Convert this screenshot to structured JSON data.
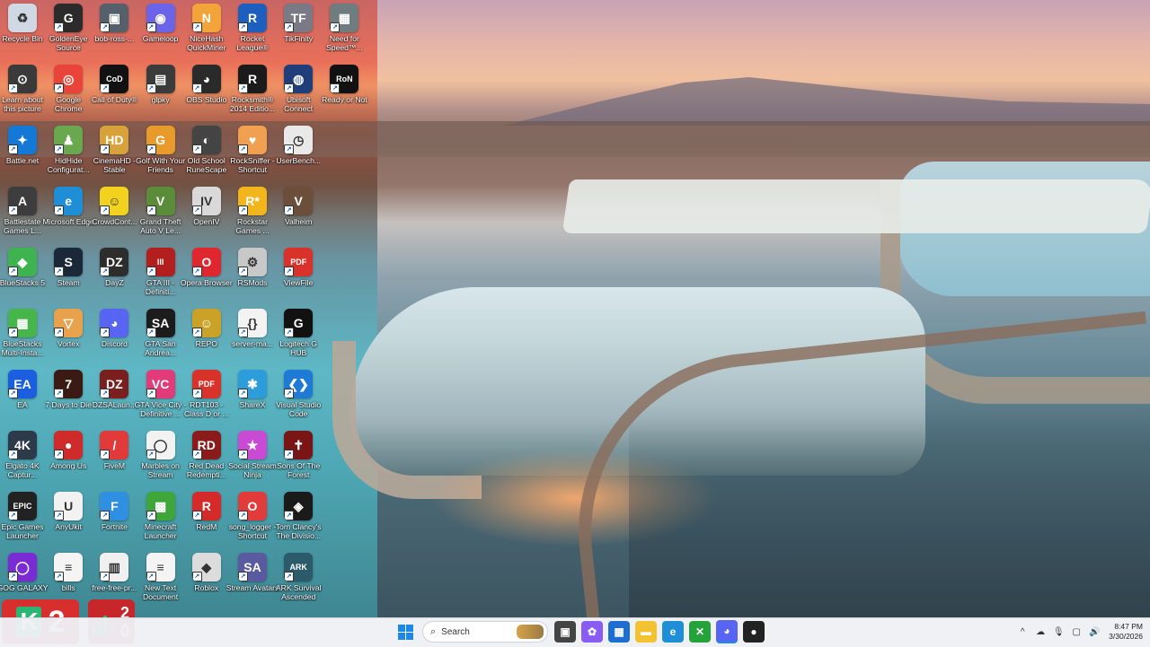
{
  "desktop": {
    "icons": [
      {
        "label": "Recycle Bin",
        "icon": "recycle-bin-icon",
        "color": "#cfd8e3",
        "glyph": "♻",
        "col": 0,
        "row": 0
      },
      {
        "label": "GoldenEye Source",
        "icon": "goldeneye-icon",
        "color": "#2b2b2b",
        "glyph": "G",
        "col": 1,
        "row": 0
      },
      {
        "label": "bob-ross-...",
        "icon": "image-file-icon",
        "color": "#55606a",
        "glyph": "▣",
        "col": 2,
        "row": 0
      },
      {
        "label": "Gameloop",
        "icon": "gameloop-icon",
        "color": "#6b64e8",
        "glyph": "◉",
        "col": 3,
        "row": 0
      },
      {
        "label": "NiceHash QuickMiner",
        "icon": "nicehash-icon",
        "color": "#f2a33a",
        "glyph": "N",
        "col": 4,
        "row": 0
      },
      {
        "label": "Rocket League®",
        "icon": "rocket-league-icon",
        "color": "#1d5fbf",
        "glyph": "R",
        "col": 5,
        "row": 0
      },
      {
        "label": "TikFinity",
        "icon": "tikfinity-icon",
        "color": "#7a7a86",
        "glyph": "TF",
        "col": 6,
        "row": 0
      },
      {
        "label": "Need for Speed™...",
        "icon": "need-for-speed-icon",
        "color": "#6f7c80",
        "glyph": "▦",
        "col": 7,
        "row": 0
      },
      {
        "label": "Learn about this picture",
        "icon": "learn-picture-icon",
        "color": "#3a3a3a",
        "glyph": "⊙",
        "col": 0,
        "row": 1
      },
      {
        "label": "Google Chrome",
        "icon": "chrome-icon",
        "color": "#e9443a",
        "glyph": "◎",
        "col": 1,
        "row": 1
      },
      {
        "label": "Call of Duty®",
        "icon": "call-of-duty-icon",
        "color": "#111111",
        "glyph": "CoD",
        "col": 2,
        "row": 1
      },
      {
        "label": "glpky",
        "icon": "glpky-icon",
        "color": "#3b3b3b",
        "glyph": "▤",
        "col": 3,
        "row": 1
      },
      {
        "label": "OBS Studio",
        "icon": "obs-icon",
        "color": "#2a2a2a",
        "glyph": "◕",
        "col": 4,
        "row": 1
      },
      {
        "label": "Rocksmith® 2014 Editio...",
        "icon": "rocksmith-icon",
        "color": "#1b1b1b",
        "glyph": "R",
        "col": 5,
        "row": 1
      },
      {
        "label": "Ubisoft Connect",
        "icon": "ubisoft-icon",
        "color": "#1f3e7a",
        "glyph": "◍",
        "col": 6,
        "row": 1
      },
      {
        "label": "Ready or Not",
        "icon": "ready-or-not-icon",
        "color": "#111111",
        "glyph": "RoN",
        "col": 7,
        "row": 1
      },
      {
        "label": "Battle.net",
        "icon": "battlenet-icon",
        "color": "#1479d6",
        "glyph": "✦",
        "col": 0,
        "row": 2
      },
      {
        "label": "HidHide Configurat...",
        "icon": "hidhide-icon",
        "color": "#6aa84f",
        "glyph": "♟",
        "col": 1,
        "row": 2
      },
      {
        "label": "CinemaHD - Stable",
        "icon": "cinemahd-icon",
        "color": "#d8a23a",
        "glyph": "HD",
        "col": 2,
        "row": 2
      },
      {
        "label": "Golf With Your Friends",
        "icon": "golf-icon",
        "color": "#e89b2a",
        "glyph": "G",
        "col": 3,
        "row": 2
      },
      {
        "label": "Old School RuneScape",
        "icon": "runescape-icon",
        "color": "#444444",
        "glyph": "◐",
        "col": 4,
        "row": 2
      },
      {
        "label": "RockSniffer - Shortcut",
        "icon": "rocksniffer-icon",
        "color": "#f0a050",
        "glyph": "♥",
        "col": 5,
        "row": 2
      },
      {
        "label": "UserBench...",
        "icon": "userbenchmark-icon",
        "color": "#e9e9e9",
        "glyph": "◷",
        "col": 6,
        "row": 2
      },
      {
        "label": "Battlestate Games L...",
        "icon": "battlestate-icon",
        "color": "#3d3d3d",
        "glyph": "A",
        "col": 0,
        "row": 3
      },
      {
        "label": "Microsoft Edge",
        "icon": "edge-icon",
        "color": "#1e8fd6",
        "glyph": "e",
        "col": 1,
        "row": 3
      },
      {
        "label": "CrowdCont...",
        "icon": "crowdcontrol-icon",
        "color": "#f2d21f",
        "glyph": "☺",
        "col": 2,
        "row": 3
      },
      {
        "label": "Grand Theft Auto V Le...",
        "icon": "gta5-icon",
        "color": "#5a8c3a",
        "glyph": "V",
        "col": 3,
        "row": 3
      },
      {
        "label": "OpenIV",
        "icon": "openiv-icon",
        "color": "#d9d9d9",
        "glyph": "IV",
        "col": 4,
        "row": 3
      },
      {
        "label": "Rockstar Games ...",
        "icon": "rockstar-icon",
        "color": "#f2b51c",
        "glyph": "R*",
        "col": 5,
        "row": 3
      },
      {
        "label": "Valheim",
        "icon": "valheim-icon",
        "color": "#6b4f3a",
        "glyph": "V",
        "col": 6,
        "row": 3
      },
      {
        "label": "BlueStacks 5",
        "icon": "bluestacks-icon",
        "color": "#3fb34f",
        "glyph": "◆",
        "col": 0,
        "row": 4
      },
      {
        "label": "Steam",
        "icon": "steam-icon",
        "color": "#1b2838",
        "glyph": "S",
        "col": 1,
        "row": 4
      },
      {
        "label": "DayZ",
        "icon": "dayz-icon",
        "color": "#2d2d2d",
        "glyph": "DZ",
        "col": 2,
        "row": 4
      },
      {
        "label": "GTA III - Definiti...",
        "icon": "gta3-icon",
        "color": "#b31f1f",
        "glyph": "III",
        "col": 3,
        "row": 4
      },
      {
        "label": "Opera Browser",
        "icon": "opera-icon",
        "color": "#e0262f",
        "glyph": "O",
        "col": 4,
        "row": 4
      },
      {
        "label": "RSMods",
        "icon": "rsmods-icon",
        "color": "#c8c8c8",
        "glyph": "⚙",
        "col": 5,
        "row": 4
      },
      {
        "label": "ViewFile",
        "icon": "pdf-viewfile-icon",
        "color": "#d8322b",
        "glyph": "PDF",
        "col": 6,
        "row": 4
      },
      {
        "label": "BlueStacks Multi-Insta...",
        "icon": "bluestacks-multi-icon",
        "color": "#47b64a",
        "glyph": "▦",
        "col": 0,
        "row": 5
      },
      {
        "label": "Vortex",
        "icon": "vortex-icon",
        "color": "#e8a24d",
        "glyph": "▽",
        "col": 1,
        "row": 5
      },
      {
        "label": "Discord",
        "icon": "discord-icon",
        "color": "#5865f2",
        "glyph": "◕",
        "col": 2,
        "row": 5
      },
      {
        "label": "GTA San Andrea...",
        "icon": "gta-sa-icon",
        "color": "#1c1c1c",
        "glyph": "SA",
        "col": 3,
        "row": 5
      },
      {
        "label": "REPO",
        "icon": "repo-icon",
        "color": "#c9a227",
        "glyph": "☺",
        "col": 4,
        "row": 5
      },
      {
        "label": "server-ma...",
        "icon": "json-file-icon",
        "color": "#f3f3f3",
        "glyph": "{}",
        "col": 5,
        "row": 5
      },
      {
        "label": "Logitech G HUB",
        "icon": "logitech-icon",
        "color": "#111111",
        "glyph": "G",
        "col": 6,
        "row": 5
      },
      {
        "label": "EA",
        "icon": "ea-icon",
        "color": "#1b5fe0",
        "glyph": "EA",
        "col": 0,
        "row": 6
      },
      {
        "label": "7 Days to Die",
        "icon": "7days-icon",
        "color": "#3a1a12",
        "glyph": "7",
        "col": 1,
        "row": 6
      },
      {
        "label": "DZSALaun...",
        "icon": "dzsa-icon",
        "color": "#7a1e1e",
        "glyph": "DZ",
        "col": 2,
        "row": 6
      },
      {
        "label": "GTA Vice City - Definitive ...",
        "icon": "gta-vc-icon",
        "color": "#e23b7a",
        "glyph": "VC",
        "col": 3,
        "row": 6
      },
      {
        "label": "RDT103 - Class D or ...",
        "icon": "pdf-rdt-icon",
        "color": "#d8322b",
        "glyph": "PDF",
        "col": 4,
        "row": 6
      },
      {
        "label": "ShareX",
        "icon": "sharex-icon",
        "color": "#2d9cdb",
        "glyph": "✱",
        "col": 5,
        "row": 6
      },
      {
        "label": "Visual Studio Code",
        "icon": "vscode-icon",
        "color": "#1f7ad6",
        "glyph": "❮❯",
        "col": 6,
        "row": 6
      },
      {
        "label": "Elgato 4K Captur...",
        "icon": "elgato-icon",
        "color": "#2d3a4a",
        "glyph": "4K",
        "col": 0,
        "row": 7
      },
      {
        "label": "Among Us",
        "icon": "among-us-icon",
        "color": "#d02b2b",
        "glyph": "●",
        "col": 1,
        "row": 7
      },
      {
        "label": "FiveM",
        "icon": "fivem-icon",
        "color": "#e23a3a",
        "glyph": "/",
        "col": 2,
        "row": 7
      },
      {
        "label": "Marbles on Stream",
        "icon": "marbles-icon",
        "color": "#f2f2f2",
        "glyph": "◯",
        "col": 3,
        "row": 7
      },
      {
        "label": "Red Dead Redempti...",
        "icon": "rdr-icon",
        "color": "#8b1a1a",
        "glyph": "RD",
        "col": 4,
        "row": 7
      },
      {
        "label": "Social Stream Ninja",
        "icon": "social-stream-icon",
        "color": "#c94bd4",
        "glyph": "★",
        "col": 5,
        "row": 7
      },
      {
        "label": "Sons Of The Forest",
        "icon": "sons-forest-icon",
        "color": "#7a1515",
        "glyph": "✝",
        "col": 6,
        "row": 7
      },
      {
        "label": "Epic Games Launcher",
        "icon": "epic-icon",
        "color": "#222222",
        "glyph": "EPIC",
        "col": 0,
        "row": 8
      },
      {
        "label": "AnyUkit",
        "icon": "anyukit-icon",
        "color": "#f2f2f2",
        "glyph": "U",
        "col": 1,
        "row": 8
      },
      {
        "label": "Fortnite",
        "icon": "fortnite-icon",
        "color": "#2f8fe0",
        "glyph": "F",
        "col": 2,
        "row": 8
      },
      {
        "label": "Minecraft Launcher",
        "icon": "minecraft-icon",
        "color": "#3fa63a",
        "glyph": "▩",
        "col": 3,
        "row": 8
      },
      {
        "label": "RedM",
        "icon": "redm-icon",
        "color": "#d52a2a",
        "glyph": "R",
        "col": 4,
        "row": 8
      },
      {
        "label": "song_logger - Shortcut",
        "icon": "song-logger-icon",
        "color": "#e23b3b",
        "glyph": "O",
        "col": 5,
        "row": 8
      },
      {
        "label": "Tom Clancy's The Divisio...",
        "icon": "division-icon",
        "color": "#1a1a1a",
        "glyph": "◈",
        "col": 6,
        "row": 8
      },
      {
        "label": "GOG GALAXY",
        "icon": "gog-icon",
        "color": "#7b2bd4",
        "glyph": "◯",
        "col": 0,
        "row": 9
      },
      {
        "label": "bills",
        "icon": "text-file-icon",
        "color": "#f4f4f4",
        "glyph": "≡",
        "col": 1,
        "row": 9
      },
      {
        "label": "free-free-pr...",
        "icon": "document-icon",
        "color": "#f0f0f0",
        "glyph": "▥",
        "col": 2,
        "row": 9
      },
      {
        "label": "New Text Document",
        "icon": "text-file-icon",
        "color": "#f4f4f4",
        "glyph": "≡",
        "col": 3,
        "row": 9
      },
      {
        "label": "Roblox",
        "icon": "roblox-icon",
        "color": "#dcdcdc",
        "glyph": "◆",
        "col": 4,
        "row": 9
      },
      {
        "label": "Stream Avatars",
        "icon": "stream-avatars-icon",
        "color": "#5a5aa0",
        "glyph": "SA",
        "col": 5,
        "row": 9
      },
      {
        "label": "ARK Survival Ascended",
        "icon": "ark-icon",
        "color": "#2b5a6a",
        "glyph": "ARK",
        "col": 6,
        "row": 9
      }
    ]
  },
  "widget": {
    "left_text": "2",
    "right_top": "2",
    "right_bottom": "0",
    "left_color": "#d92e2e",
    "right_color": "#c7272a",
    "accent_green": "#2bb673"
  },
  "taskbar": {
    "search_placeholder": "Search",
    "apps": [
      {
        "name": "start-button",
        "icon": "windows-logo-icon",
        "color": "#1e88e5",
        "glyph": "⊞"
      },
      {
        "name": "task-view",
        "icon": "task-view-icon",
        "color": "#444444",
        "glyph": "▣"
      },
      {
        "name": "copilot",
        "icon": "copilot-icon",
        "color": "#8a5cf6",
        "glyph": "✿"
      },
      {
        "name": "store",
        "icon": "store-icon",
        "color": "#1c6fd1",
        "glyph": "▦"
      },
      {
        "name": "file-explorer",
        "icon": "folder-icon",
        "color": "#f2c230",
        "glyph": "▬"
      },
      {
        "name": "edge",
        "icon": "edge-icon",
        "color": "#1e8fd6",
        "glyph": "e"
      },
      {
        "name": "xbox",
        "icon": "xbox-icon",
        "color": "#23a33a",
        "glyph": "✕"
      },
      {
        "name": "discord",
        "icon": "discord-icon",
        "color": "#5865f2",
        "glyph": "◕"
      },
      {
        "name": "steam-app",
        "icon": "game-app-icon",
        "color": "#222222",
        "glyph": "●"
      }
    ],
    "tray": [
      {
        "name": "show-hidden",
        "glyph": "^"
      },
      {
        "name": "onedrive",
        "glyph": "☁"
      },
      {
        "name": "microphone",
        "glyph": "🎙"
      },
      {
        "name": "network",
        "glyph": "▢"
      },
      {
        "name": "volume",
        "glyph": "🔊"
      }
    ],
    "clock_time": "8:47 PM",
    "clock_date": "3/30/2026"
  }
}
